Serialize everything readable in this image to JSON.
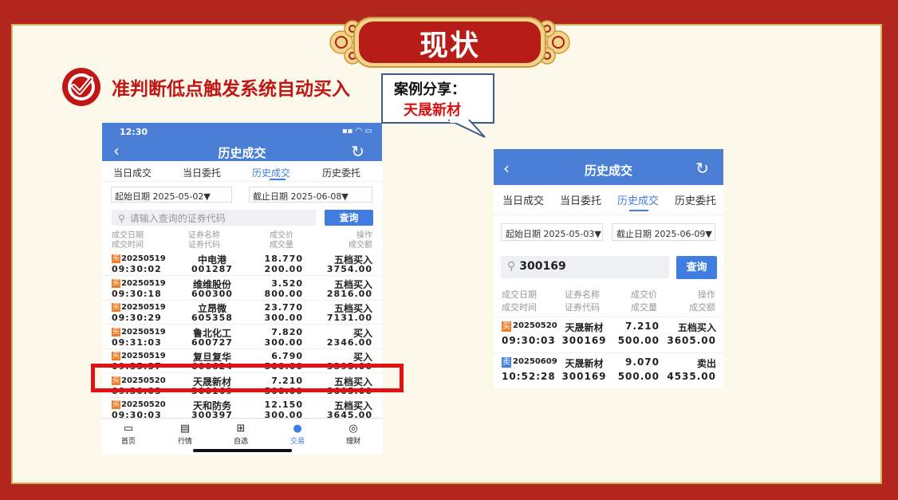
{
  "slide": {
    "title": "现状",
    "heading": "准判断低点触发系统自动买入",
    "callout_line1": "案例分享：",
    "callout_line2": "天晟新材"
  },
  "colors": {
    "background": "#b3261e",
    "accent_red": "#c01616",
    "app_blue": "#4a7fd5",
    "buy_badge": "#f07f2a",
    "sell_badge": "#3f7ee0",
    "highlight": "#e31111"
  },
  "phone_left": {
    "status_time": "12:30",
    "back_icon": "chevron-left-icon",
    "title": "历史成交",
    "refresh_icon": "refresh-icon",
    "tabs": [
      "当日成交",
      "当日委托",
      "历史成交",
      "历史委托"
    ],
    "active_tab": 2,
    "start_date": "起始日期 2025-05-02▼",
    "end_date": "截止日期 2025-06-08▼",
    "search_placeholder": "请输入查询的证券代码",
    "query_label": "查询",
    "columns": [
      [
        "成交日期",
        "成交时间"
      ],
      [
        "证券名称",
        "证券代码"
      ],
      [
        "成交价",
        "成交量"
      ],
      [
        "操作",
        "成交额"
      ]
    ],
    "rows": [
      {
        "badge": "买",
        "date": "20250519",
        "time": "09:30:02",
        "name": "中电港",
        "code": "001287",
        "price": "18.770",
        "qty": "200.00",
        "op": "五档买入",
        "amount": "3754.00"
      },
      {
        "badge": "买",
        "date": "20250519",
        "time": "09:30:18",
        "name": "维维股份",
        "code": "600300",
        "price": "3.520",
        "qty": "800.00",
        "op": "五档买入",
        "amount": "2816.00"
      },
      {
        "badge": "买",
        "date": "20250519",
        "time": "09:30:29",
        "name": "立昂微",
        "code": "605358",
        "price": "23.770",
        "qty": "300.00",
        "op": "五档买入",
        "amount": "7131.00"
      },
      {
        "badge": "买",
        "date": "20250519",
        "time": "09:31:03",
        "name": "鲁北化工",
        "code": "600727",
        "price": "7.820",
        "qty": "300.00",
        "op": "买入",
        "amount": "2346.00"
      },
      {
        "badge": "买",
        "date": "20250519",
        "time": "09:35:37",
        "name": "复旦复华",
        "code": "600624",
        "price": "6.790",
        "qty": "500.00",
        "op": "买入",
        "amount": "3395.00"
      },
      {
        "badge": "买",
        "date": "20250520",
        "time": "09:30:03",
        "name": "天晟新材",
        "code": "300169",
        "price": "7.210",
        "qty": "500.00",
        "op": "五档买入",
        "amount": "3605.00"
      },
      {
        "badge": "买",
        "date": "20250520",
        "time": "09:30:03",
        "name": "天和防务",
        "code": "300397",
        "price": "12.150",
        "qty": "300.00",
        "op": "五档买入",
        "amount": "3645.00"
      }
    ],
    "nav": [
      {
        "icon": "home-icon",
        "label": "首页"
      },
      {
        "icon": "chart-icon",
        "label": "行情"
      },
      {
        "icon": "add-watchlist-icon",
        "label": "自选"
      },
      {
        "icon": "trade-icon",
        "label": "交易"
      },
      {
        "icon": "wealth-icon",
        "label": "理财"
      }
    ],
    "active_nav": 3
  },
  "phone_right": {
    "back_icon": "chevron-left-icon",
    "title": "历史成交",
    "refresh_icon": "refresh-icon",
    "tabs": [
      "当日成交",
      "当日委托",
      "历史成交",
      "历史委托"
    ],
    "active_tab": 2,
    "start_date": "起始日期 2025-05-03▼",
    "end_date": "截止日期 2025-06-09▼",
    "search_value": "300169",
    "query_label": "查询",
    "columns": [
      [
        "成交日期",
        "成交时间"
      ],
      [
        "证券名称",
        "证券代码"
      ],
      [
        "成交价",
        "成交量"
      ],
      [
        "操作",
        "成交额"
      ]
    ],
    "rows": [
      {
        "badge": "买",
        "badge_color": "#f07f2a",
        "date": "20250520",
        "time": "09:30:03",
        "name": "天晟新材",
        "code": "300169",
        "price": "7.210",
        "qty": "500.00",
        "op": "五档买入",
        "amount": "3605.00"
      },
      {
        "badge": "卖",
        "badge_color": "#3f7ee0",
        "date": "20250609",
        "time": "10:52:28",
        "name": "天晟新材",
        "code": "300169",
        "price": "9.070",
        "qty": "500.00",
        "op": "卖出",
        "amount": "4535.00"
      }
    ]
  }
}
